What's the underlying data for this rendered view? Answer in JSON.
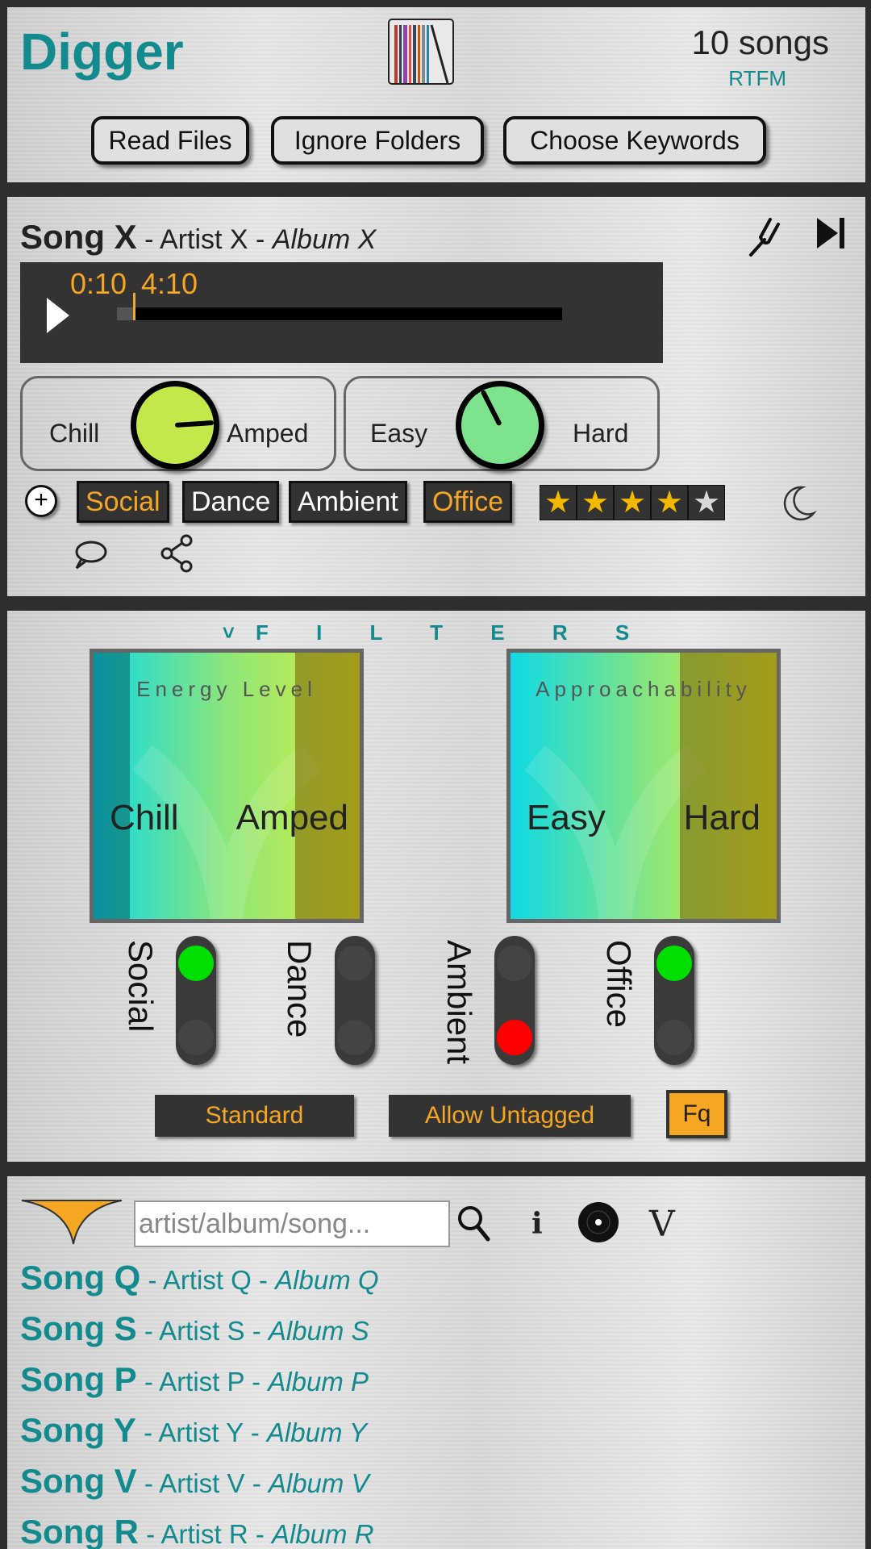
{
  "header": {
    "app_title": "Digger",
    "song_count": "10 songs",
    "rtfm_link": "RTFM",
    "buttons": {
      "read_files": "Read Files",
      "ignore_folders": "Ignore Folders",
      "choose_keywords": "Choose Keywords"
    }
  },
  "now_playing": {
    "song": "Song X",
    "sep1": " - ",
    "artist": "Artist X",
    "sep2": " - ",
    "album": "Album X",
    "time_current": "0:10",
    "time_total": "4:10",
    "progress_fraction": 0.04,
    "energy_knob": {
      "left_label": "Chill",
      "right_label": "Amped",
      "value_fraction": 0.82
    },
    "approach_knob": {
      "left_label": "Easy",
      "right_label": "Hard",
      "value_fraction": 0.4
    },
    "add_tag_symbol": "+",
    "tags": [
      {
        "label": "Social",
        "active": true
      },
      {
        "label": "Dance",
        "active": false
      },
      {
        "label": "Ambient",
        "active": false
      },
      {
        "label": "Office",
        "active": true
      }
    ],
    "rating": {
      "value": 4,
      "max": 5
    },
    "icons": [
      "tuning-fork-icon",
      "skip-next-icon",
      "moon-icon",
      "comment-icon",
      "share-icon"
    ]
  },
  "filters": {
    "title": "˅F I L T E R S",
    "energy": {
      "label": "Energy Level",
      "left": "Chill",
      "right": "Amped"
    },
    "approachability": {
      "label": "Approachability",
      "left": "Easy",
      "right": "Hard"
    },
    "toggles": [
      {
        "label": "Social",
        "state": "on"
      },
      {
        "label": "Dance",
        "state": "neutral"
      },
      {
        "label": "Ambient",
        "state": "off"
      },
      {
        "label": "Office",
        "state": "on"
      }
    ],
    "buttons": {
      "standard": "Standard",
      "allow_untagged": "Allow Untagged",
      "fq": "Fq"
    },
    "colors": {
      "accent": "#f5a623",
      "on": "#00e000",
      "off": "#ff0000"
    }
  },
  "library": {
    "search_placeholder": "artist/album/song...",
    "info_symbol": "i",
    "v_symbol": "V",
    "songs": [
      {
        "song": "Song Q",
        "artist": "Artist Q",
        "album": "Album Q"
      },
      {
        "song": "Song S",
        "artist": "Artist S",
        "album": "Album S"
      },
      {
        "song": "Song P",
        "artist": "Artist P",
        "album": "Album P"
      },
      {
        "song": "Song Y",
        "artist": "Artist Y",
        "album": "Album Y"
      },
      {
        "song": "Song V",
        "artist": "Artist V",
        "album": "Album V"
      },
      {
        "song": "Song R",
        "artist": "Artist R",
        "album": "Album R"
      }
    ],
    "sep": " - "
  },
  "colors": {
    "brand": "#138a8d",
    "accent": "#f5a623",
    "dark": "#333333"
  }
}
